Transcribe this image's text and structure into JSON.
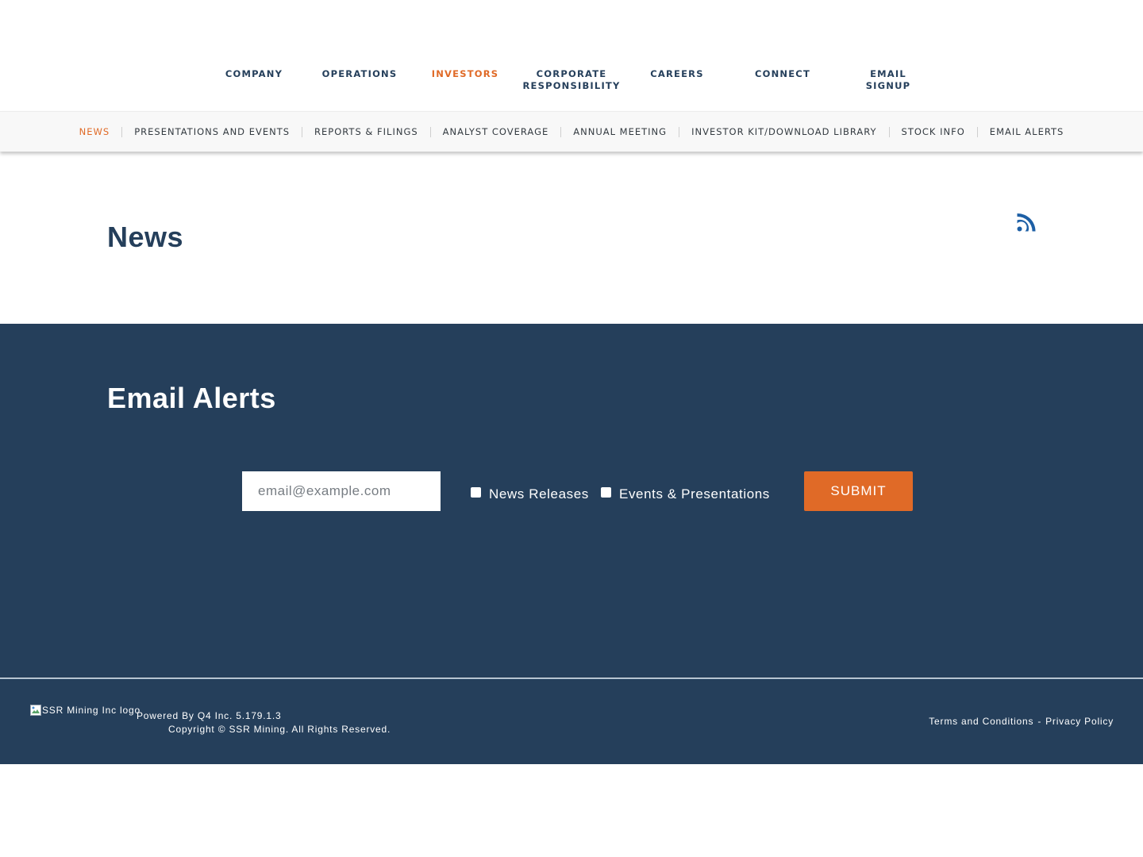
{
  "top_nav": {
    "items": [
      {
        "label": "COMPANY"
      },
      {
        "label": "OPERATIONS"
      },
      {
        "label": "INVESTORS",
        "active": true
      },
      {
        "label": "CORPORATE RESPONSIBILITY"
      },
      {
        "label": "CAREERS"
      },
      {
        "label": "CONNECT"
      },
      {
        "label": "EMAIL SIGNUP"
      }
    ]
  },
  "sub_nav": {
    "items": [
      {
        "label": "NEWS",
        "active": true
      },
      {
        "label": "PRESENTATIONS AND EVENTS"
      },
      {
        "label": "REPORTS & FILINGS"
      },
      {
        "label": "ANALYST COVERAGE"
      },
      {
        "label": "ANNUAL MEETING"
      },
      {
        "label": "INVESTOR KIT/DOWNLOAD LIBRARY"
      },
      {
        "label": "STOCK INFO"
      },
      {
        "label": "EMAIL ALERTS"
      }
    ]
  },
  "news": {
    "title": "News",
    "rss_icon": "rss-icon"
  },
  "email_alerts": {
    "title": "Email Alerts",
    "email_placeholder": "email@example.com",
    "email_value": "",
    "checkboxes": [
      {
        "label": "News Releases",
        "checked": false
      },
      {
        "label": "Events & Presentations",
        "checked": false
      }
    ],
    "submit_label": "SUBMIT"
  },
  "footer": {
    "logo_alt": "SSR Mining Inc logo",
    "powered_by": "Powered By Q4 Inc. 5.179.1.3",
    "copyright": "Copyright © SSR Mining. All Rights Reserved.",
    "terms_label": "Terms and Conditions",
    "separator": "-",
    "privacy_label": "Privacy Policy"
  },
  "colors": {
    "navy": "#253f5b",
    "accent_orange": "#e06a27",
    "rss_blue": "#1d5fa5",
    "subnav_bg": "#f8f8f8"
  }
}
